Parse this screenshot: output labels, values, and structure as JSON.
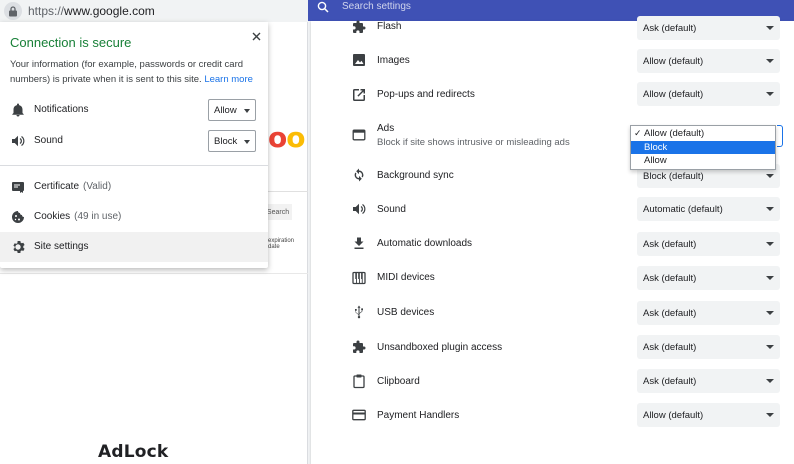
{
  "browser": {
    "url_scheme": "https://",
    "url_host": "www.google.com"
  },
  "background_page": {
    "logo_fragment_1": "o",
    "logo_fragment_2": "o",
    "search_label": "Search",
    "expiration_text": "expiration date"
  },
  "site_info_popup": {
    "title": "Connection is secure",
    "description": "Your information (for example, passwords or credit card numbers) is private when it is sent to this site.",
    "learn_more": "Learn more",
    "permissions": [
      {
        "label": "Notifications",
        "value": "Allow",
        "icon": "bell-icon"
      },
      {
        "label": "Sound",
        "value": "Block",
        "icon": "speaker-icon"
      }
    ],
    "links": [
      {
        "label": "Certificate",
        "detail": "(Valid)",
        "icon": "certificate-icon"
      },
      {
        "label": "Cookies",
        "detail": "(49 in use)",
        "icon": "cookie-icon"
      },
      {
        "label": "Site settings",
        "detail": "",
        "icon": "gear-icon"
      }
    ],
    "title_color": "#188038",
    "link_color": "#1a73e8"
  },
  "watermark": "AdLock",
  "settings": {
    "search_placeholder": "Search settings",
    "header_color": "#3f51b5",
    "rows": [
      {
        "label": "Flash",
        "value": "Ask (default)",
        "icon": "puzzle-icon"
      },
      {
        "label": "Images",
        "value": "Allow (default)",
        "icon": "image-icon"
      },
      {
        "label": "Pop-ups and redirects",
        "value": "Allow (default)",
        "icon": "open-in-new-icon"
      },
      {
        "label": "Ads",
        "sublabel": "Block if site shows intrusive or misleading ads",
        "value": "Allow (default)",
        "icon": "ads-window-icon"
      },
      {
        "label": "Background sync",
        "value": "Block (default)",
        "icon": "sync-icon"
      },
      {
        "label": "Sound",
        "value": "Automatic (default)",
        "icon": "speaker-icon"
      },
      {
        "label": "Automatic downloads",
        "value": "Ask (default)",
        "icon": "download-icon"
      },
      {
        "label": "MIDI devices",
        "value": "Ask (default)",
        "icon": "piano-keys-icon"
      },
      {
        "label": "USB devices",
        "value": "Ask (default)",
        "icon": "usb-icon"
      },
      {
        "label": "Unsandboxed plugin access",
        "value": "Ask (default)",
        "icon": "puzzle-icon"
      },
      {
        "label": "Clipboard",
        "value": "Ask (default)",
        "icon": "clipboard-icon"
      },
      {
        "label": "Payment Handlers",
        "value": "Allow (default)",
        "icon": "credit-card-icon"
      }
    ],
    "ads_dropdown": {
      "options": [
        "Allow (default)",
        "Block",
        "Allow"
      ],
      "checked_index": 0,
      "highlighted_index": 1,
      "check_mark": "✓"
    }
  }
}
